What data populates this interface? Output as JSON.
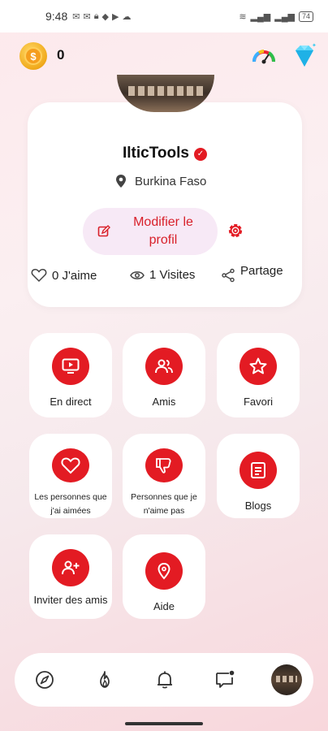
{
  "status_bar": {
    "time": "9:48",
    "battery": "74"
  },
  "header": {
    "coins": "0"
  },
  "profile": {
    "username": "IlticTools",
    "location": "Burkina Faso",
    "edit_label": "Modifier le profil",
    "likes": "0 J'aime",
    "visits": "1 Visites",
    "share": "Partage"
  },
  "tiles": [
    {
      "label": "En direct"
    },
    {
      "label": "Amis"
    },
    {
      "label": "Favori"
    },
    {
      "label": "Les personnes que j'ai aimées"
    },
    {
      "label": "Personnes que je n'aime pas"
    },
    {
      "label": "Blogs"
    },
    {
      "label": "Inviter des amis"
    },
    {
      "label": "Aide"
    }
  ],
  "colors": {
    "accent": "#e31b23",
    "edit_bg": "#f7e9f6"
  },
  "icons": [
    "coin-icon",
    "speedometer-icon",
    "diamond-icon",
    "verified-icon",
    "location-pin-icon",
    "edit-icon",
    "settings-icon",
    "heart-icon",
    "eye-icon",
    "share-icon",
    "play-icon",
    "friends-icon",
    "star-icon",
    "thumbs-down-icon",
    "blog-icon",
    "add-user-icon",
    "help-icon",
    "compass-icon",
    "fire-icon",
    "bell-icon",
    "chat-icon"
  ]
}
